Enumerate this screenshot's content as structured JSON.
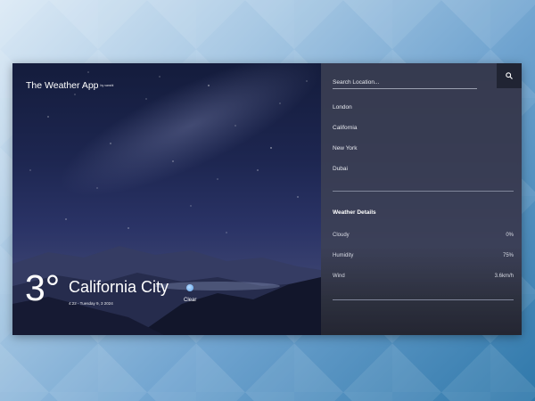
{
  "brand": {
    "title": "The Weather App",
    "byline": "by vanshl"
  },
  "current": {
    "temperature": "3°",
    "city": "California City",
    "datetime": "4:22 - Tuesday 9, 3 2024",
    "condition": "Clear",
    "condition_icon": "moon-cloud-icon"
  },
  "search": {
    "placeholder": "Search Location...",
    "button_icon": "search-icon"
  },
  "locations": [
    "London",
    "California",
    "New York",
    "Dubai"
  ],
  "details": {
    "title": "Weather Details",
    "rows": [
      {
        "label": "Cloudy",
        "value": "0%"
      },
      {
        "label": "Humidity",
        "value": "75%"
      },
      {
        "label": "Wind",
        "value": "3.6km/h"
      }
    ]
  },
  "colors": {
    "panel": "#3e4254",
    "search_button": "#202433",
    "sky": "#1d2650"
  }
}
